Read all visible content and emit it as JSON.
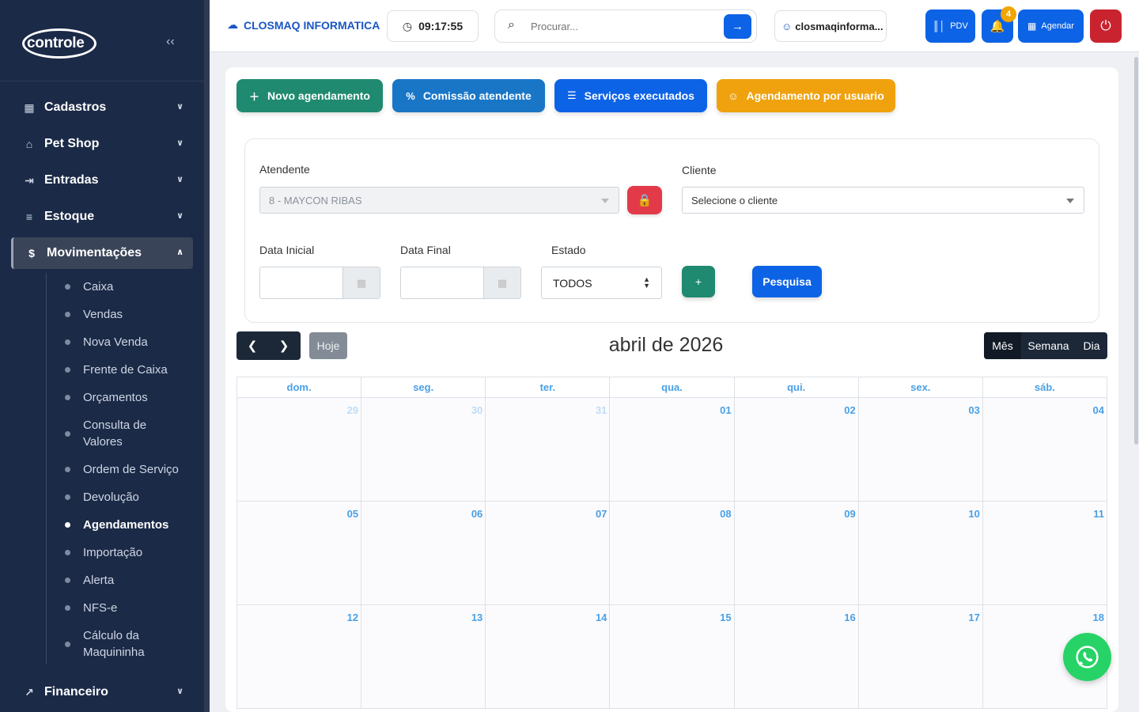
{
  "sidebar": {
    "logo": "controle",
    "collapse_icon": "chevrons-left-icon",
    "menu": [
      {
        "label": "Cadastros",
        "icon": "grid-icon"
      },
      {
        "label": "Pet Shop",
        "icon": "store-icon"
      },
      {
        "label": "Entradas",
        "icon": "login-icon"
      },
      {
        "label": "Estoque",
        "icon": "list-icon"
      },
      {
        "label": "Movimentações",
        "icon": "dollar-icon"
      },
      {
        "label": "Financeiro",
        "icon": "chart-line-icon"
      }
    ],
    "submenu": [
      "Caixa",
      "Vendas",
      "Nova Venda",
      "Frente de Caixa",
      "Orçamentos",
      "Consulta de Valores",
      "Ordem de Serviço",
      "Devolução",
      "Agendamentos",
      "Importação",
      "Alerta",
      "NFS-e",
      "Cálculo da Maquininha"
    ],
    "active_submenu": "Agendamentos"
  },
  "topbar": {
    "company": "CLOSMAQ INFORMATICA",
    "time": "09:17:55",
    "search_placeholder": "Procurar...",
    "username": "closmaqinforma...",
    "pdv_label": "PDV",
    "notification_count": "4",
    "agendar_label": "Agendar",
    "brand_color": "#0d63e6",
    "danger_color": "#c9232f"
  },
  "actions": {
    "novo": "Novo agendamento",
    "comissao": "Comissão atendente",
    "servicos": "Serviços executados",
    "usuario": "Agendamento por usuario"
  },
  "filters": {
    "atendente_label": "Atendente",
    "atendente_value": "8 - MAYCON RIBAS",
    "cliente_label": "Cliente",
    "cliente_value": "Selecione o cliente",
    "data_inicial_label": "Data Inicial",
    "data_final_label": "Data Final",
    "data_inicial_value": "",
    "data_final_value": "",
    "estado_label": "Estado",
    "estado_value": "TODOS",
    "plus_label": "+",
    "pesquisa_label": "Pesquisa"
  },
  "calendar": {
    "title": "abril de 2026",
    "today_label": "Hoje",
    "views": {
      "month": "Mês",
      "week": "Semana",
      "day": "Dia"
    },
    "active_view": "Mês",
    "weekdays": [
      "dom.",
      "seg.",
      "ter.",
      "qua.",
      "qui.",
      "sex.",
      "sáb."
    ],
    "weeks": [
      [
        {
          "d": "29",
          "other": true
        },
        {
          "d": "30",
          "other": true
        },
        {
          "d": "31",
          "other": true
        },
        {
          "d": "01"
        },
        {
          "d": "02"
        },
        {
          "d": "03"
        },
        {
          "d": "04"
        }
      ],
      [
        {
          "d": "05"
        },
        {
          "d": "06"
        },
        {
          "d": "07"
        },
        {
          "d": "08"
        },
        {
          "d": "09"
        },
        {
          "d": "10"
        },
        {
          "d": "11"
        }
      ],
      [
        {
          "d": "12"
        },
        {
          "d": "13"
        },
        {
          "d": "14"
        },
        {
          "d": "15"
        },
        {
          "d": "16"
        },
        {
          "d": "17"
        },
        {
          "d": "18"
        }
      ]
    ]
  }
}
